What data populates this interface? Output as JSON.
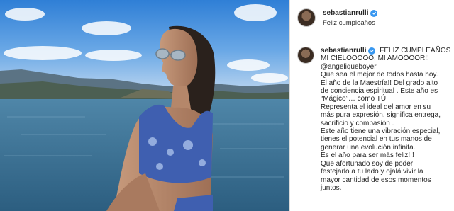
{
  "header": {
    "username": "sebastianrulli",
    "subtitle": "Feliz cumpleaños",
    "avatar_icon": "profile-avatar",
    "verified_icon": "verified-badge-icon"
  },
  "caption": {
    "username": "sebastianrulli",
    "first_line": "FELIZ CUMPLEAÑOS",
    "lines": [
      "MI CIELOOOOO, MI AMOOOOR!!",
      "@angeliqueboyer",
      "Que sea el mejor de todos hasta hoy.",
      "El año de la Maestría!! Del grado alto",
      "de conciencia espiritual . Este año es",
      "“Mágico”… como TÚ",
      "Representa el ideal del amor en su",
      "más pura expresión, significa entrega,",
      "sacrificio y compasión .",
      "Este año tiene una vibración especial,",
      "tienes el potencial en tus manos de",
      "generar una evolución infinita.",
      "Es el año para ser más feliz!!!",
      "Que afortunado soy de poder",
      "festejarlo a tu lado y ojalá vivir la",
      "mayor cantidad de esos momentos",
      "juntos."
    ]
  },
  "colors": {
    "verified": "#3897f0",
    "text": "#262626",
    "border": "#dbdbdb"
  }
}
